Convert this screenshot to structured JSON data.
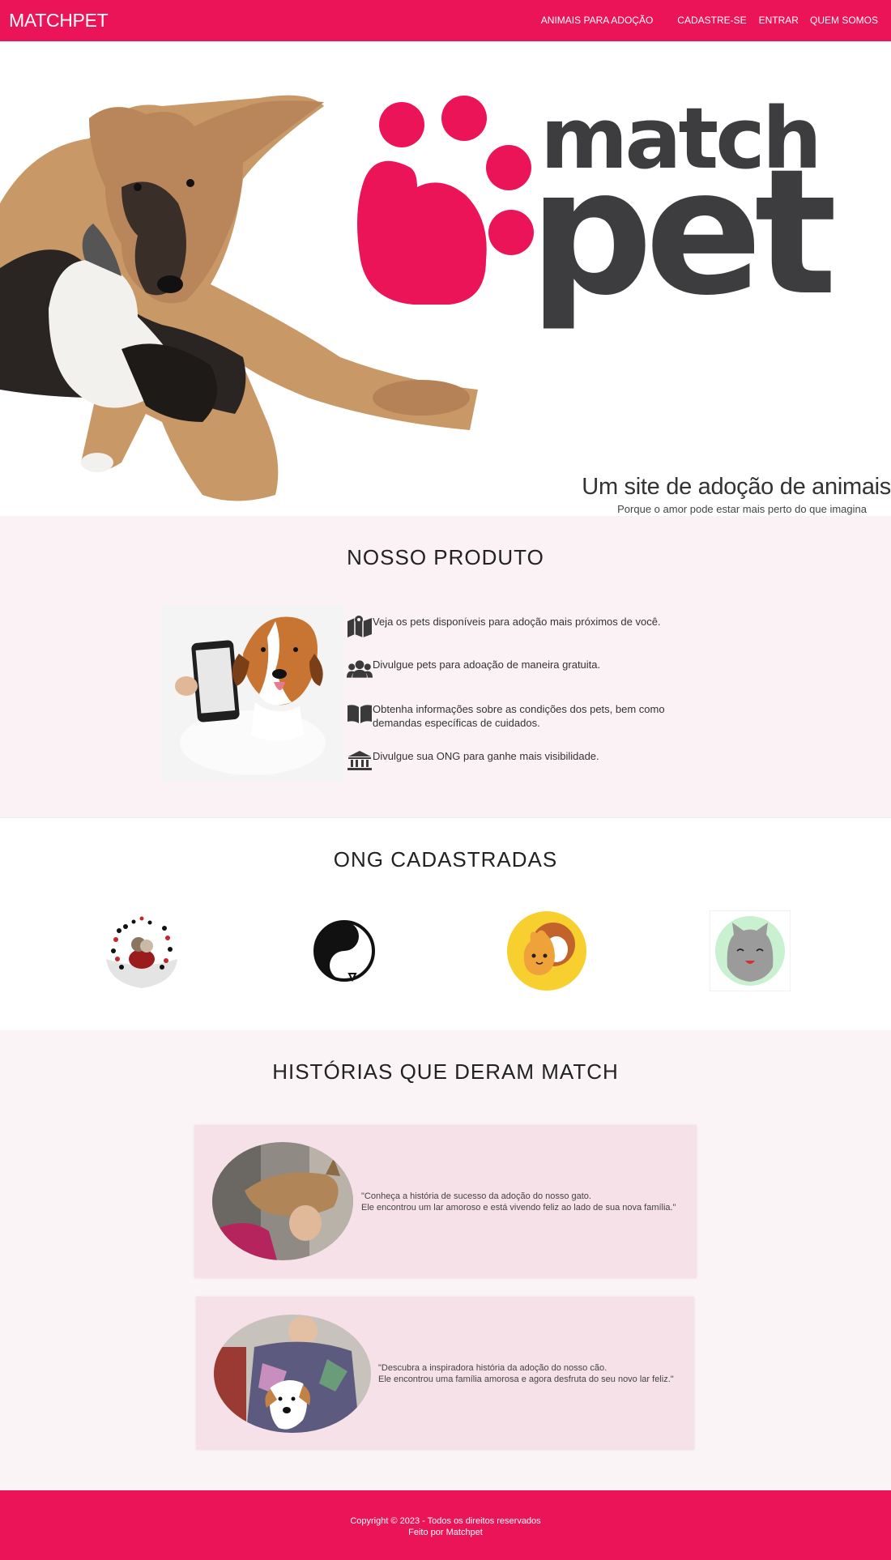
{
  "nav": {
    "brand": "MATCHPET",
    "links": [
      "ANIMAIS PARA ADOÇÃO",
      "CADASTRE-SE",
      "ENTRAR",
      "QUEM SOMOS"
    ]
  },
  "hero": {
    "logo_top": "match",
    "logo_bottom": "pet",
    "title": "Um site de adoção de animais",
    "subtitle": "Porque o amor pode estar mais perto do que imagina"
  },
  "produto": {
    "title": "NOSSO PRODUTO",
    "features": [
      {
        "icon": "map-icon",
        "text": "Veja os pets disponíveis para adoção mais próximos de você."
      },
      {
        "icon": "users-icon",
        "text": "Divulgue pets para adoação de maneira gratuita."
      },
      {
        "icon": "book-icon",
        "text": "Obtenha informações sobre as condições dos pets, bem como demandas específicas de cuidados."
      },
      {
        "icon": "institution-icon",
        "text": "Divulgue sua ONG para ganhe mais visibilidade."
      }
    ]
  },
  "ongs": {
    "title": "ONG CADASTRADAS"
  },
  "historias": {
    "title": "HISTÓRIAS QUE DERAM MATCH",
    "stories": [
      {
        "line1": "\"Conheça a história de sucesso da adoção do nosso gato.",
        "line2": "Ele encontrou um lar amoroso e está vivendo feliz ao lado de sua nova família.\""
      },
      {
        "line1": "\"Descubra a inspiradora história da adoção do nosso cão.",
        "line2": "Ele encontrou uma família amorosa e agora desfruta do seu novo lar feliz.\""
      }
    ]
  },
  "footer": {
    "copyright": "Copyright © 2023 - Todos os direitos reservados",
    "made_by": "Feito por Matchpet"
  },
  "colors": {
    "brand": "#ec1459",
    "logo_gray": "#3d3d3f",
    "section_bg": "#faf2f4",
    "story_bg": "#f5e1e7"
  }
}
